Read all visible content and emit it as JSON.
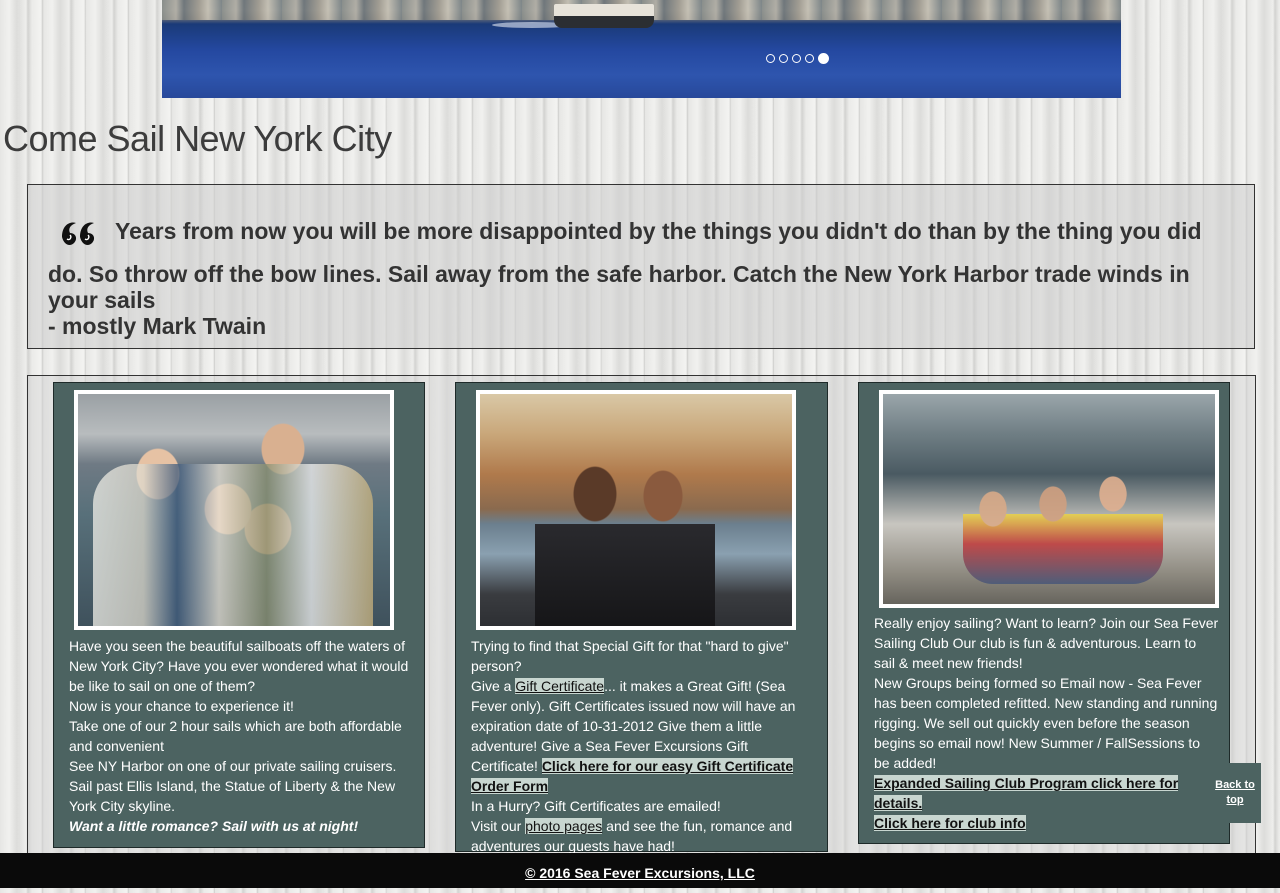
{
  "hero": {
    "slide_count": 5,
    "active_slide": 5
  },
  "page": {
    "title": "Come Sail New York City"
  },
  "quote": {
    "icon": "quote-icon",
    "line1": "Years from now you will be more disappointed by the things you didn't do than by the thing you did",
    "line2": "do. So throw off the bow lines. Sail away from the safe harbor. Catch the New York Harbor trade winds in your sails",
    "attribution": "- mostly Mark Twain"
  },
  "card1": {
    "p1": "Have you seen the beautiful sailboats off the waters of New York City? Have you ever wondered what it would be like to sail on one of them?",
    "p2": "Now is your chance to experience it!",
    "p3": "Take one of our 2 hour sails which are both affordable and convenient",
    "p4": "See NY Harbor on one of our private sailing cruisers. Sail past Ellis Island, the Statue of Liberty & the New York City skyline.",
    "p5": "Want a little romance? Sail with us at night!"
  },
  "card2": {
    "p1": "Trying to find that Special Gift for that \"hard to give\" person?",
    "p2a": "Give a ",
    "link_gift": "Gift Certificate",
    "p2b": "... it makes a Great Gift!  (Sea Fever only). Gift Certificates issued now will have an expiration date of 10-31-2012 Give them a little adventure!  Give a Sea Fever Excursions Gift Certificate! ",
    "link_order": "Click here for our easy Gift Certificate Order Form",
    "p3": "In a Hurry? Gift Certificates are emailed!",
    "p4a": "Visit our ",
    "link_photos": "photo pages",
    "p4b": " and see the fun, romance and adventures our guests have had!"
  },
  "card3": {
    "p1": "Really enjoy sailing? Want to learn? Join our Sea Fever Sailing Club Our club is fun & adventurous. Learn to sail & meet new friends!",
    "p2": "New Groups being formed so Email now -   Sea Fever has been completed refitted. New standing and running rigging. We sell out quickly even before the season begins so email now! New Summer / FallSessions to be added!",
    "link_expanded": "Expanded Sailing Club Program click here for details.",
    "link_club": "Click here for club info"
  },
  "back_to_top": "Back to top",
  "footer": {
    "text": "© 2016 Sea Fever Excursions, LLC"
  }
}
